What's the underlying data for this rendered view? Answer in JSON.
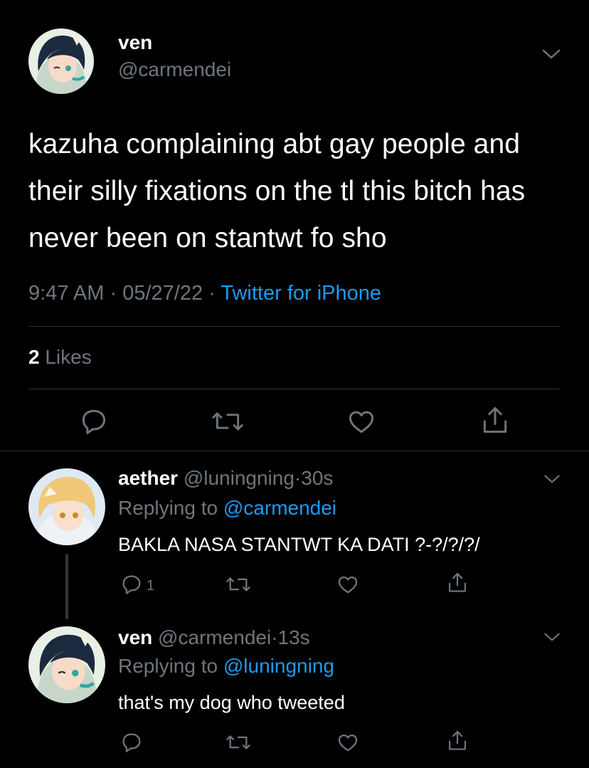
{
  "main_tweet": {
    "display_name": "ven",
    "handle": "@carmendei",
    "text": "kazuha complaining abt gay people and their silly fixations on the tl this bitch has never been on stantwt fo sho",
    "time": "9:47 AM",
    "separator": "·",
    "date": "05/27/22",
    "source": "Twitter for iPhone",
    "likes_count": "2",
    "likes_label": "Likes"
  },
  "replies": [
    {
      "display_name": "aether",
      "handle": "@luningning",
      "separator": "·",
      "time": "30s",
      "replying_label": "Replying to",
      "replying_to": "@carmendei",
      "text": "BAKLA NASA STANTWT KA DATI ?-?/?/?/",
      "reply_count": "1"
    },
    {
      "display_name": "ven",
      "handle": "@carmendei",
      "separator": "·",
      "time": "13s",
      "replying_label": "Replying to",
      "replying_to": "@luningning",
      "text": "that's my dog who tweeted"
    }
  ],
  "icons": [
    "reply-icon",
    "retweet-icon",
    "like-icon",
    "share-icon",
    "chevron-down-icon"
  ],
  "colors": {
    "background": "#000000",
    "text": "#ffffff",
    "muted": "#6e767d",
    "link": "#1d9bf0",
    "divider": "#2f3336"
  }
}
